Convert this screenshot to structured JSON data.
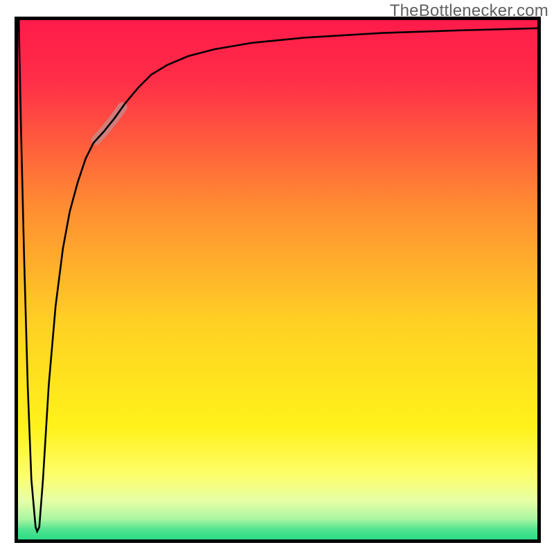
{
  "watermark": "TheBottleneсker.com",
  "chart_data": {
    "type": "line",
    "title": "",
    "xlabel": "",
    "ylabel": "",
    "xlim": [
      0,
      100
    ],
    "ylim": [
      0,
      100
    ],
    "legend": false,
    "grid": false,
    "gradient": [
      {
        "pos": 0.0,
        "color": "#ff1a4a"
      },
      {
        "pos": 0.12,
        "color": "#ff2d48"
      },
      {
        "pos": 0.36,
        "color": "#ff8c32"
      },
      {
        "pos": 0.58,
        "color": "#ffd024"
      },
      {
        "pos": 0.78,
        "color": "#fff21a"
      },
      {
        "pos": 0.87,
        "color": "#fdfe6a"
      },
      {
        "pos": 0.92,
        "color": "#e6ffa5"
      },
      {
        "pos": 0.955,
        "color": "#a9f5a2"
      },
      {
        "pos": 0.975,
        "color": "#4fe38e"
      },
      {
        "pos": 1.0,
        "color": "#1fd985"
      }
    ],
    "series": [
      {
        "name": "bottleneck-curve",
        "color": "#000000",
        "width": 2.6,
        "x": [
          0.8,
          1.2,
          1.8,
          2.5,
          3.2,
          4.0,
          4.3,
          4.7,
          5.4,
          6.5,
          7.8,
          9.2,
          10.5,
          12.0,
          13.5,
          15.0,
          17.0,
          19.0,
          21.0,
          23.5,
          26.0,
          29.0,
          33.0,
          38.0,
          45.0,
          55.0,
          70.0,
          85.0,
          100.0
        ],
        "values": [
          99.5,
          80.0,
          55.0,
          30.0,
          12.0,
          3.0,
          2.2,
          3.0,
          12.0,
          30.0,
          45.0,
          56.0,
          63.0,
          68.5,
          73.0,
          76.0,
          78.2,
          80.7,
          83.5,
          86.5,
          89.0,
          90.8,
          92.5,
          93.8,
          95.0,
          96.0,
          96.9,
          97.4,
          97.8
        ]
      }
    ],
    "highlight": {
      "x_range": [
        15.5,
        20.5
      ],
      "color": "#c48a8a",
      "opacity": 0.78,
      "thickness": 14
    }
  }
}
